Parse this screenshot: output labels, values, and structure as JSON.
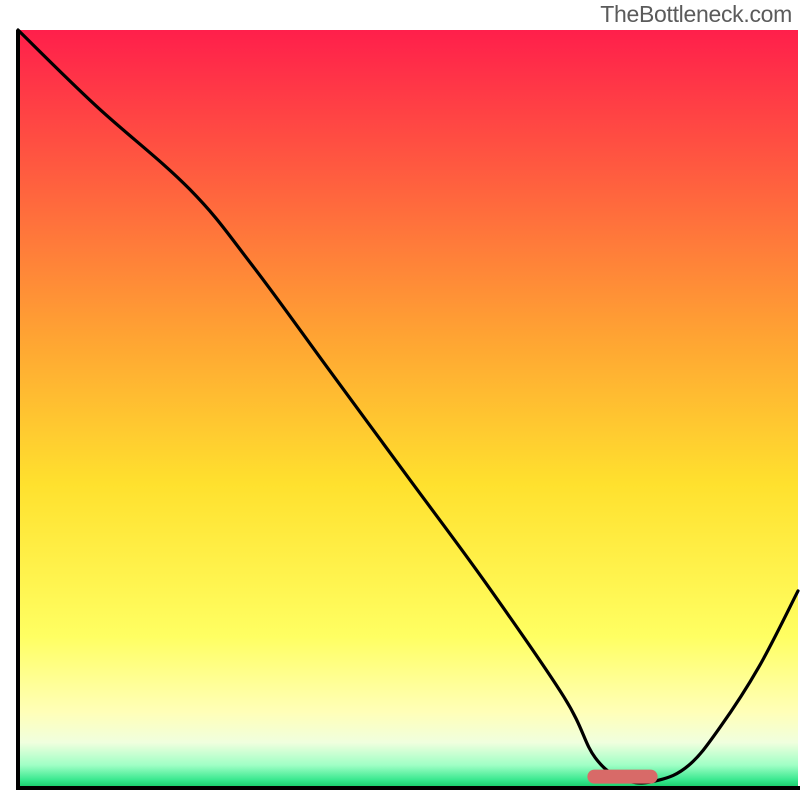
{
  "attribution": "TheBottleneck.com",
  "colors": {
    "gradient_top": "#ff1f4b",
    "gradient_mid_red": "#ff5940",
    "gradient_mid_orange": "#ffa233",
    "gradient_mid_yellow": "#ffe12e",
    "gradient_pale_yellow": "#ffff99",
    "gradient_light": "#f4ffdd",
    "gradient_cyan": "#4cffbf",
    "gradient_green": "#17d36b",
    "curve": "#000000",
    "marker": "#d86a68",
    "axis": "#000000"
  },
  "chart_data": {
    "type": "line",
    "title": "",
    "xlabel": "",
    "ylabel": "",
    "xlim": [
      0,
      100
    ],
    "ylim": [
      0,
      100
    ],
    "grid": false,
    "legend": false,
    "series": [
      {
        "name": "bottleneck-curve",
        "x": [
          0,
          10,
          22,
          30,
          40,
          50,
          60,
          70,
          74,
          78,
          82,
          86,
          90,
          95,
          100
        ],
        "y": [
          100,
          90,
          79,
          69,
          55,
          41,
          27,
          12,
          4,
          1,
          1,
          3,
          8,
          16,
          26
        ]
      }
    ],
    "marker": {
      "x_start": 73,
      "x_end": 82,
      "y": 1.5
    },
    "gradient_stops_pct": [
      0,
      18,
      40,
      60,
      80,
      90,
      94,
      97,
      99,
      100
    ]
  }
}
